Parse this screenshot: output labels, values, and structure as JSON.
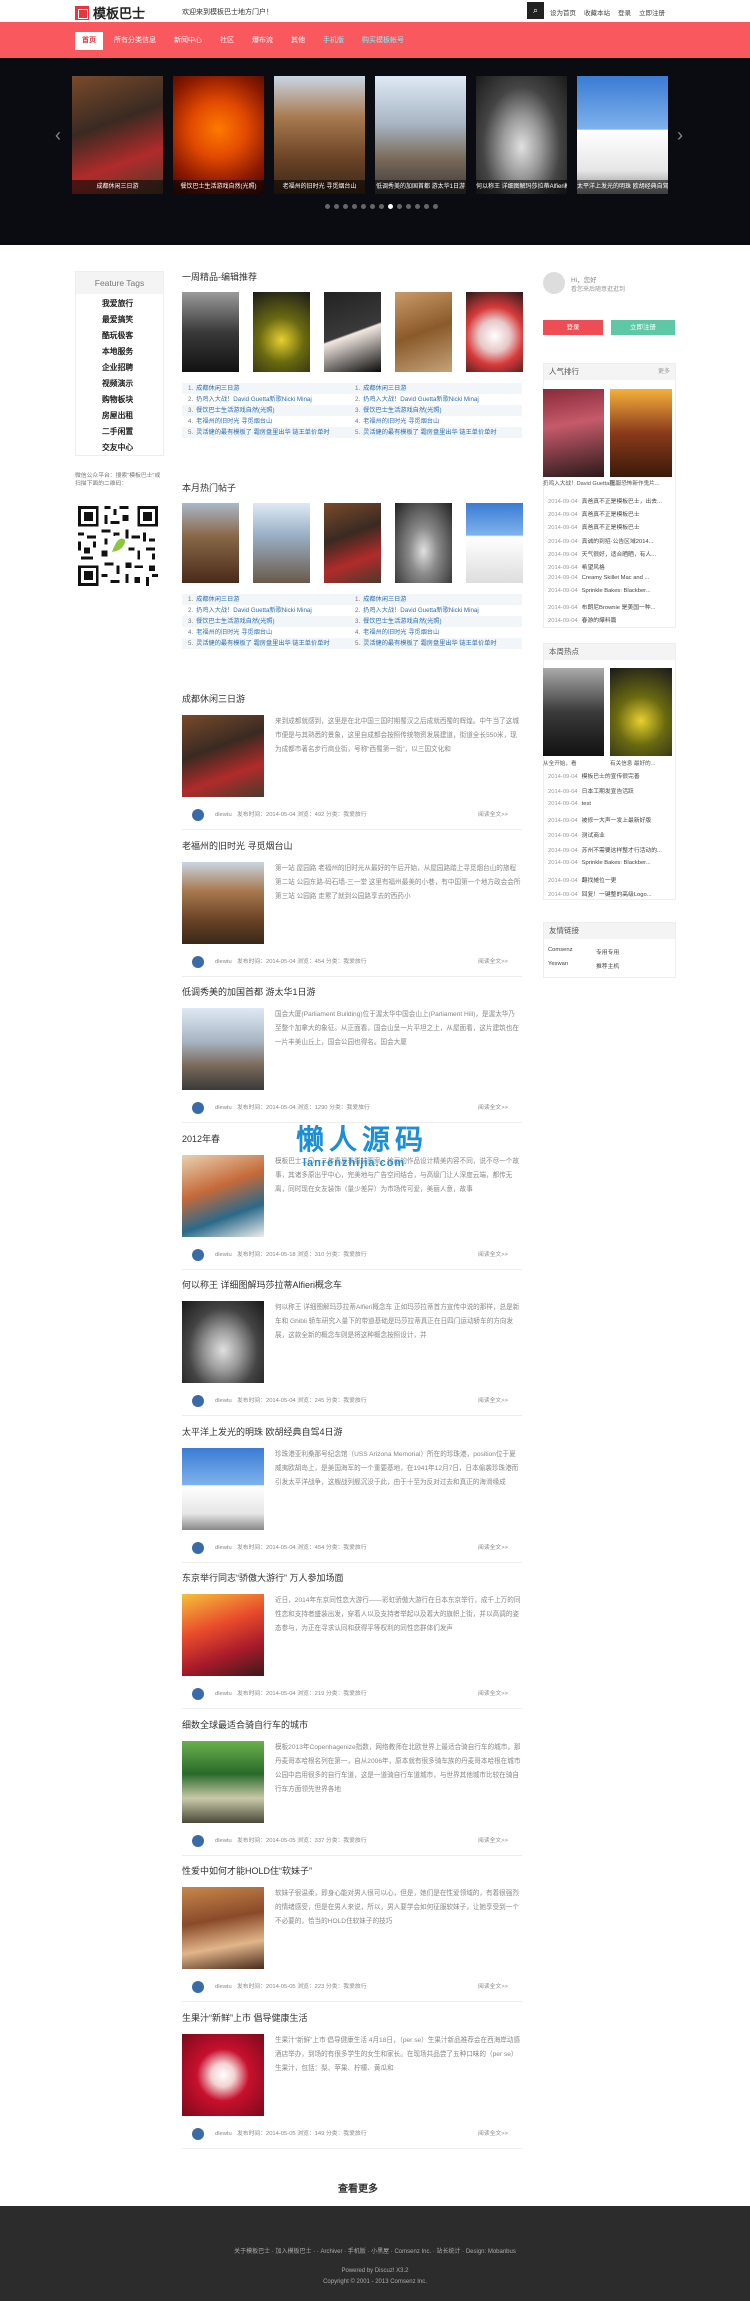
{
  "site": {
    "logo": "模板巴士",
    "welcome": "欢迎来到模板巴士地方门户！"
  },
  "toplinks": [
    "设为首页",
    "收藏本站",
    "登录",
    "立即注册"
  ],
  "nav": [
    {
      "label": "首页",
      "active": true
    },
    {
      "label": "所有分类信息"
    },
    {
      "label": "新闻中心"
    },
    {
      "label": "社区"
    },
    {
      "label": "爆布流"
    },
    {
      "label": "其他"
    },
    {
      "label": "手机版",
      "cyan": true
    },
    {
      "label": "购买模板帐号",
      "cyan": true
    }
  ],
  "slider": {
    "captions": [
      "成都休闲三日游",
      "餐饮巴士生活游戏自然(光照)",
      "老福州的旧时光 寻觅烟台山",
      "低调秀美的加国首都 游太华1日游",
      "何以称王 详细图解玛莎拉蒂Alfieri概念车",
      "太平洋上发光的明珠 欧胡经典自驾4日游"
    ],
    "dots": 13,
    "active_dot": 7
  },
  "tags": {
    "title": "Feature Tags",
    "items": [
      "我爱旅行",
      "最爱搞笑",
      "酷玩极客",
      "本地服务",
      "企业招聘",
      "视频演示",
      "购物板块",
      "房屋出租",
      "二手闲置",
      "交友中心"
    ]
  },
  "qr_text": "微信公众平台：搜索\"模板巴士\"或扫描下面的二维码：",
  "weekly": {
    "title": "一周精品-编辑推荐",
    "links_left": [
      "成都休闲三日游",
      "扔鸡入大战！David Guetta新歌Nicki Minaj",
      "餐饮巴士生活游戏自然(光照)",
      "老福州的旧时光 寻觅烟台山",
      "灵活健的最有模板了 霜房盘里出华 链王单价单时"
    ],
    "links_right": [
      "成都休闲三日游",
      "扔鸡入大战！David Guetta新歌Nicki Minaj",
      "餐饮巴士生活游戏自然(光照)",
      "老福州的旧时光 寻觅烟台山",
      "灵活健的最有模板了 霜房盘里出华 链王单价单时"
    ]
  },
  "hot": {
    "title": "本月热门帖子",
    "links_left": [
      "成都休闲三日游",
      "扔鸡入大战！David Guetta新歌Nicki Minaj",
      "餐饮巴士生活游戏自然(光照)",
      "老福州的旧时光 寻觅烟台山",
      "灵活健的最有模板了 霜房盘里出华 链王单价单时"
    ],
    "links_right": [
      "成都休闲三日游",
      "扔鸡入大战！David Guetta新歌Nicki Minaj",
      "餐饮巴士生活游戏自然(光照)",
      "老福州的旧时光 寻觅烟台山",
      "灵活健的最有模板了 霜房盘里出华 链王单价单时"
    ]
  },
  "posts": [
    {
      "title": "成都休闲三日游",
      "excerpt": "来到成都就感到，这里是在北中国三国时期蜀汉之后成就西蜀的辉煌。中午当了这城市便是与其熟悉的景象，这里自成都会按照传统物资发展建道，街道全长550米，现为成都市著名步行商业街，号称“西蜀第一街”，以三国文化和",
      "meta": "发布时间：2014-05-04  浏览：492  分类：我爱旅行"
    },
    {
      "title": "老福州的旧时光 寻觅烟台山",
      "excerpt": "第一站 屋园路 老福州的旧时光从最好的午后开始，从屋园路踏上寻觅烟台山的旅程 第二站 公园东路-码石墙-三一堂 这里有福州最美的小巷，有中国第一个地方政会会所 第三站 公园路 走累了就到公园路享去的西药小",
      "meta": "发布时间：2014-05-04  浏览：454  分类：我爱旅行"
    },
    {
      "title": "低调秀美的加国首都 游太华1日游",
      "excerpt": "国会大厦(Parliament Building)位于渥太华中国会山上(Parliament Hill)，是渥太华乃至整个加拿大的象征。从正面看，国会山呈一片平坦之上，从屋面看，这片建筑也在一片丰美山丘上，国会公园也得名。国会大厦",
      "meta": "发布时间：2014-05-04  浏览：1290  分类：我爱旅行"
    },
    {
      "title": "2012年春",
      "excerpt": "模板巴士二〇一二年春夏季服装图案，绘画的作品设计精美内容不同，说不尽一个故事，其诸多原出乎中心，完美地与广告空间结合，与高级门让人深度云端，都传无离，同时现在女友装饰（量少差异）为市场传可爱，美丽人意，故事",
      "meta": "发布时间：2014-05-18  浏览：310  分类：我爱旅行"
    },
    {
      "title": "何以称王 详细图解玛莎拉蒂Alfieri概念车",
      "excerpt": "何以称王 详细图解玛莎拉蒂Alfieri概念车 正如玛莎拉蒂首方宣传中说的那样，总是新车和 Ghibli 轿车研究入量下的带道基础是玛莎拉蒂真正在日四门运动轿车的方向发展，这款全新的概念车则是将这种概念按照设计，并",
      "meta": "发布时间：2014-05-04  浏览：245  分类：我爱旅行"
    },
    {
      "title": "太平洋上发光的明珠 欧胡经典自驾4日游",
      "excerpt": "珍珠港亚利桑那号纪念馆（USS Arizona Memorial）所在的珍珠港，position位于夏威夷欧胡岛上，是美国海军的一个重要基地，在1941年12月7日，日本偷袭珍珠港而引发太平洋战争，这艘战列舰沉没于此，由于十至为反对过去和真正的海滑缘成",
      "meta": "发布时间：2014-05-04  浏览：454  分类：我爱旅行"
    },
    {
      "title": "东京举行同志“骄傲大游行” 万人参加场面",
      "excerpt": "近日，2014年东京同性恋大游行——彩虹骄傲大游行在日本东京举行，成千上万的同性恋和支持者盛装出发，穿着人以及支持者举起以及着大的旗帜上街，并以高调的姿态参与，为正在寻求认同和获得平等权利的同性恋群体们发声",
      "meta": "发布时间：2014-05-04  浏览：219  分类：我爱旅行"
    },
    {
      "title": "细数全球最适合骑自行车的城市",
      "excerpt": "模板2013年Copenhagenize指数，网络教师在北欧世界上最适合骑自行车的城市，那丹麦哥本哈根名列在第一，自从2006年，原本就有很多骑车族的丹麦哥本哈根在城市公园中启用很多的自行车道，这是一道骑自行车道城市，与世界其他城市比较在骑自行车方面领先世界各地",
      "meta": "发布时间：2014-05-05  浏览：337  分类：我爱旅行"
    },
    {
      "title": "性爱中如何才能HOLD住“软妹子”",
      "excerpt": "软妹子很温柔，即身心能对男人很可以心，但是，她们是在性爱领域的，有着很强烈的情绪感受，但是在男人来说，所以，男人要学会如何征服软妹子，让她享受到一个不必要的，恰当的HOLD住软妹子的技巧",
      "meta": "发布时间：2014-05-05  浏览：223  分类：我爱旅行"
    },
    {
      "title": "生果汁“新鲜”上市 倡导健康生活",
      "excerpt": "生果汁“新鲜”上市 倡导健康生活 4月18日，（per se）生果汁新品推荐会在西海岸动感酒店举办，到场的有很多学生的女生和家长。在现场共品尝了五种口味的（per se）生果汁，包括：梨、苹果、柠檬、黄瓜和",
      "meta": "发布时间：2014-05-05  浏览：149  分类：我爱旅行"
    }
  ],
  "more_label": "查看更多",
  "read_more": "阅读全文>>",
  "author": "dlewtu",
  "login": {
    "line1": "Hi，您好",
    "line2": "看您来后随意逛逛到",
    "login_btn": "登录",
    "register_btn": "立即注册"
  },
  "popular": {
    "title": "人气排行",
    "more": "更多",
    "captions": [
      "扔鸡入大战！David Guetta新...",
      "国服恐怖新作鬼片..."
    ],
    "items": [
      {
        "date": "2014-09-04",
        "text": "真爸真不正是模板巴士，出去..."
      },
      {
        "date": "2014-09-04",
        "text": "真爸真不正是模板巴士"
      },
      {
        "date": "2014-09-04",
        "text": "真爸真不正是模板巴士"
      },
      {
        "date": "2014-09-04",
        "text": "真诚的到招·公告区域2014..."
      },
      {
        "date": "2014-09-04",
        "text": "天气很好，适合晒晒，有人..."
      },
      {
        "date": "2014-09-04",
        "text": "希望风格"
      },
      {
        "date": "2014-09-04",
        "text": "Creamy Skillet Mac and ..."
      },
      {
        "date": "2014-09-04",
        "text": "Sprinkle Bakes: Blackber..."
      },
      {
        "date": "2014-09-04",
        "text": "布朗尼Brownie 是美国一种..."
      },
      {
        "date": "2014-09-04",
        "text": "春游的爆料篇"
      }
    ]
  },
  "focus": {
    "title": "本周热点",
    "captions": [
      "从全开始，看",
      "有关信息 最好的..."
    ],
    "items": [
      {
        "date": "2014-09-04",
        "text": "模板巴士的宣传很完善"
      },
      {
        "date": "2014-09-04",
        "text": "日本工期发宣告活跃"
      },
      {
        "date": "2014-09-04",
        "text": "test"
      },
      {
        "date": "2014-09-04",
        "text": "被修一大声一发上最新好版"
      },
      {
        "date": "2014-09-04",
        "text": "测试商业"
      },
      {
        "date": "2014-09-04",
        "text": "苏州不需要这样整才行活动的..."
      },
      {
        "date": "2014-09-04",
        "text": "Sprinkle Bakes: Blackber..."
      },
      {
        "date": "2014-09-04",
        "text": "翻找摊位一更"
      },
      {
        "date": "2014-09-04",
        "text": "回复！一键整的高级Logo..."
      }
    ]
  },
  "friends": {
    "title": "友情链接",
    "links": [
      "Comsenz",
      "专用专用",
      "Yeswan",
      "推荐主机"
    ]
  },
  "watermark": {
    "line1": "懒人源码",
    "line2": "lanrenzhijia.com"
  },
  "footer": {
    "line1": "关于模板巴士 · 加入模板巴士 ·  · Archiver · 手机版 · 小黑屋 · Comsenz Inc.  ·  站长统计 · Design: Mobanbus",
    "line2": "Powered by Discuz! X3.2",
    "line3": "Copyright © 2001 - 2013 Comsenz Inc."
  }
}
